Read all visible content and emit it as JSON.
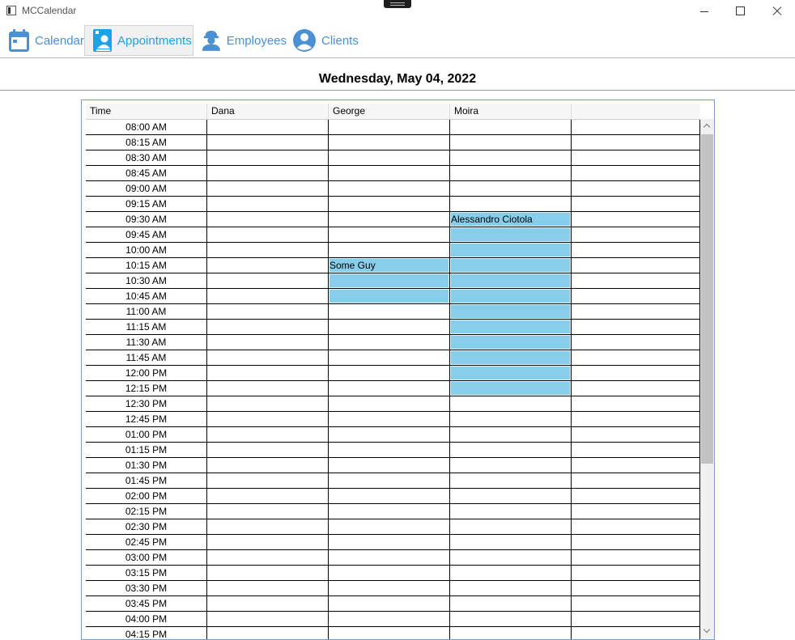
{
  "window": {
    "title": "MCCalendar"
  },
  "nav": [
    {
      "label": "Calendar",
      "icon": "calendar-icon",
      "active": false
    },
    {
      "label": "Appointments",
      "icon": "appointment-book-icon",
      "active": true
    },
    {
      "label": "Employees",
      "icon": "employee-hardhat-icon",
      "active": false
    },
    {
      "label": "Clients",
      "icon": "client-person-icon",
      "active": false
    }
  ],
  "date_heading": "Wednesday, May 04, 2022",
  "schedule": {
    "columns": [
      "Time",
      "Dana",
      "George",
      "Moira",
      ""
    ],
    "rows": [
      {
        "time": "08:00 AM",
        "dana": "",
        "george": "",
        "moira": "",
        "extra": "",
        "booked": []
      },
      {
        "time": "08:15 AM",
        "dana": "",
        "george": "",
        "moira": "",
        "extra": "",
        "booked": []
      },
      {
        "time": "08:30 AM",
        "dana": "",
        "george": "",
        "moira": "",
        "extra": "",
        "booked": []
      },
      {
        "time": "08:45 AM",
        "dana": "",
        "george": "",
        "moira": "",
        "extra": "",
        "booked": []
      },
      {
        "time": "09:00 AM",
        "dana": "",
        "george": "",
        "moira": "",
        "extra": "",
        "booked": []
      },
      {
        "time": "09:15 AM",
        "dana": "",
        "george": "",
        "moira": "",
        "extra": "",
        "booked": []
      },
      {
        "time": "09:30 AM",
        "dana": "",
        "george": "",
        "moira": "Alessandro Ciotola",
        "extra": "",
        "booked": [
          "moira"
        ]
      },
      {
        "time": "09:45 AM",
        "dana": "",
        "george": "",
        "moira": "",
        "extra": "",
        "booked": [
          "moira"
        ]
      },
      {
        "time": "10:00 AM",
        "dana": "",
        "george": "",
        "moira": "",
        "extra": "",
        "booked": [
          "moira"
        ]
      },
      {
        "time": "10:15 AM",
        "dana": "",
        "george": "Some Guy",
        "moira": "",
        "extra": "",
        "booked": [
          "george",
          "moira"
        ]
      },
      {
        "time": "10:30 AM",
        "dana": "",
        "george": "",
        "moira": "",
        "extra": "",
        "booked": [
          "george",
          "moira"
        ]
      },
      {
        "time": "10:45 AM",
        "dana": "",
        "george": "",
        "moira": "",
        "extra": "",
        "booked": [
          "george",
          "moira"
        ]
      },
      {
        "time": "11:00 AM",
        "dana": "",
        "george": "",
        "moira": "",
        "extra": "",
        "booked": [
          "moira"
        ]
      },
      {
        "time": "11:15 AM",
        "dana": "",
        "george": "",
        "moira": "",
        "extra": "",
        "booked": [
          "moira"
        ]
      },
      {
        "time": "11:30 AM",
        "dana": "",
        "george": "",
        "moira": "",
        "extra": "",
        "booked": [
          "moira"
        ]
      },
      {
        "time": "11:45 AM",
        "dana": "",
        "george": "",
        "moira": "",
        "extra": "",
        "booked": [
          "moira"
        ]
      },
      {
        "time": "12:00 PM",
        "dana": "",
        "george": "",
        "moira": "",
        "extra": "",
        "booked": [
          "moira"
        ]
      },
      {
        "time": "12:15 PM",
        "dana": "",
        "george": "",
        "moira": "",
        "extra": "",
        "booked": [
          "moira"
        ]
      },
      {
        "time": "12:30 PM",
        "dana": "",
        "george": "",
        "moira": "",
        "extra": "",
        "booked": []
      },
      {
        "time": "12:45 PM",
        "dana": "",
        "george": "",
        "moira": "",
        "extra": "",
        "booked": []
      },
      {
        "time": "01:00 PM",
        "dana": "",
        "george": "",
        "moira": "",
        "extra": "",
        "booked": []
      },
      {
        "time": "01:15 PM",
        "dana": "",
        "george": "",
        "moira": "",
        "extra": "",
        "booked": []
      },
      {
        "time": "01:30 PM",
        "dana": "",
        "george": "",
        "moira": "",
        "extra": "",
        "booked": []
      },
      {
        "time": "01:45 PM",
        "dana": "",
        "george": "",
        "moira": "",
        "extra": "",
        "booked": []
      },
      {
        "time": "02:00 PM",
        "dana": "",
        "george": "",
        "moira": "",
        "extra": "",
        "booked": []
      },
      {
        "time": "02:15 PM",
        "dana": "",
        "george": "",
        "moira": "",
        "extra": "",
        "booked": []
      },
      {
        "time": "02:30 PM",
        "dana": "",
        "george": "",
        "moira": "",
        "extra": "",
        "booked": []
      },
      {
        "time": "02:45 PM",
        "dana": "",
        "george": "",
        "moira": "",
        "extra": "",
        "booked": []
      },
      {
        "time": "03:00 PM",
        "dana": "",
        "george": "",
        "moira": "",
        "extra": "",
        "booked": []
      },
      {
        "time": "03:15 PM",
        "dana": "",
        "george": "",
        "moira": "",
        "extra": "",
        "booked": []
      },
      {
        "time": "03:30 PM",
        "dana": "",
        "george": "",
        "moira": "",
        "extra": "",
        "booked": []
      },
      {
        "time": "03:45 PM",
        "dana": "",
        "george": "",
        "moira": "",
        "extra": "",
        "booked": []
      },
      {
        "time": "04:00 PM",
        "dana": "",
        "george": "",
        "moira": "",
        "extra": "",
        "booked": []
      },
      {
        "time": "04:15 PM",
        "dana": "",
        "george": "",
        "moira": "",
        "extra": "",
        "booked": []
      }
    ]
  },
  "colors": {
    "accent": "#4a90d2",
    "active_tab_text": "#1aa3e8",
    "booked_slot": "#87ceeb",
    "grid_border": "#7a9cc8"
  }
}
